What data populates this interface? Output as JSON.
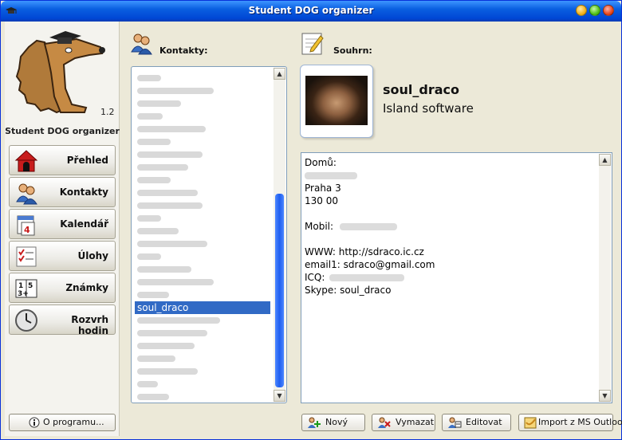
{
  "window": {
    "title": "Student DOG organizer"
  },
  "sidebar": {
    "version": "1.2",
    "app_name": "Student DOG organizer",
    "nav": [
      {
        "label": "Přehled",
        "icon": "doghouse-icon"
      },
      {
        "label": "Kontakty",
        "icon": "people-icon"
      },
      {
        "label": "Kalendář",
        "icon": "calendar-icon"
      },
      {
        "label": "Úlohy",
        "icon": "checklist-icon"
      },
      {
        "label": "Známky",
        "icon": "grades-book-icon"
      },
      {
        "label": "Rozvrh hodin",
        "icon": "clock-icon"
      }
    ],
    "about_label": "O programu..."
  },
  "contacts": {
    "title": "Kontakty:",
    "selected": "soul_draco"
  },
  "summary": {
    "title": "Souhrn:",
    "name": "soul_draco",
    "organization": "Island software",
    "details": {
      "home_label": "Domů:",
      "city": "Praha 3",
      "zip": "130 00",
      "mobile_label": "Mobil:",
      "www": "WWW: http://sdraco.ic.cz",
      "email": "email1: sdraco@gmail.com",
      "icq_label": "ICQ:",
      "skype": "Skype: soul_draco"
    }
  },
  "actions": {
    "new": "Nový",
    "delete": "Vymazat",
    "edit": "Editovat",
    "import": "Import z MS Outlook"
  }
}
